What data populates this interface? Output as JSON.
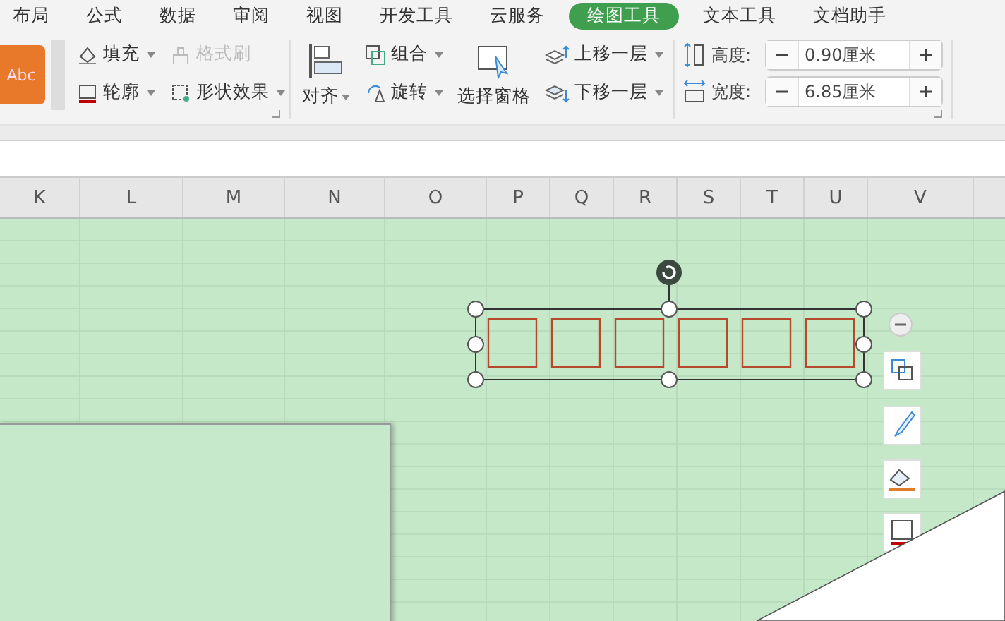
{
  "menu_tabs": [
    {
      "label": "布局",
      "selected": false
    },
    {
      "label": "公式",
      "selected": false
    },
    {
      "label": "数据",
      "selected": false
    },
    {
      "label": "审阅",
      "selected": false
    },
    {
      "label": "视图",
      "selected": false
    },
    {
      "label": "开发工具",
      "selected": false
    },
    {
      "label": "云服务",
      "selected": false
    },
    {
      "label": "绘图工具",
      "selected": true
    },
    {
      "label": "文本工具",
      "selected": false
    },
    {
      "label": "文档助手",
      "selected": false
    }
  ],
  "ribbon": {
    "style_preview": "Abc",
    "format_tools": [
      {
        "label": "填充",
        "disabled": false
      },
      {
        "label": "格式刷",
        "disabled": true
      },
      {
        "label": "轮廓",
        "disabled": false
      },
      {
        "label": "形状效果",
        "disabled": false
      }
    ],
    "align": "对齐",
    "group": "组合",
    "rotate": "旋转",
    "selection_pane": "选择窗格",
    "bring_forward": "上移一层",
    "send_backward": "下移一层",
    "size_fields": [
      {
        "label": "高度:",
        "value": "0.90厘米"
      },
      {
        "label": "宽度:",
        "value": "6.85厘米"
      }
    ]
  },
  "sheet": {
    "columns": [
      "K",
      "L",
      "M",
      "N",
      "O",
      "P",
      "Q",
      "R",
      "S",
      "T",
      "U",
      "V"
    ]
  }
}
